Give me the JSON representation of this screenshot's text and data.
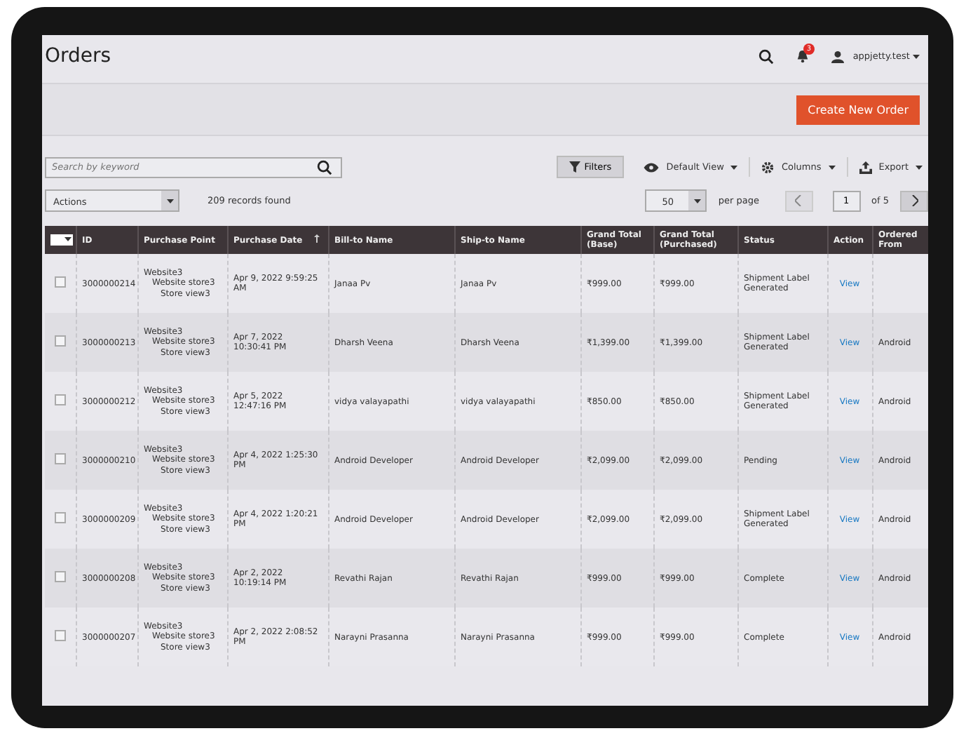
{
  "page": {
    "title": "Orders"
  },
  "header": {
    "notifications": "3",
    "user": "appjetty.test"
  },
  "create_button": "Create New Order",
  "search": {
    "placeholder": "Search by keyword"
  },
  "toolbar": {
    "filters": "Filters",
    "view": "Default View",
    "columns": "Columns",
    "export": "Export"
  },
  "actions": "Actions",
  "records": "209 records found",
  "pager": {
    "per_page_value": "50",
    "per_page_label": "per page",
    "page": "1",
    "of": "of 5"
  },
  "table": {
    "columns": [
      {
        "label": "ID",
        "sorted": false
      },
      {
        "label": "Purchase Point",
        "sorted": false
      },
      {
        "label": "Purchase Date",
        "sorted": true
      },
      {
        "label": "Bill-to Name",
        "sorted": false
      },
      {
        "label": "Ship-to Name",
        "sorted": false
      },
      {
        "label": "Grand Total (Base)",
        "sorted": false
      },
      {
        "label": "Grand Total (Purchased)",
        "sorted": false
      },
      {
        "label": "Status",
        "sorted": false
      },
      {
        "label": "Action",
        "sorted": false
      },
      {
        "label": "Ordered From",
        "sorted": false
      }
    ],
    "rows": [
      {
        "selected": false,
        "id": "3000000214",
        "point": [
          "Website3",
          "Website store3",
          "Store view3"
        ],
        "date": "Apr 9, 2022 9:59:25 AM",
        "bill": "Janaa Pv",
        "ship": "Janaa Pv",
        "base": "₹999.00",
        "purchased": "₹999.00",
        "status": "Shipment Label Generated",
        "action": "View"
      },
      {
        "selected": false,
        "id": "3000000213",
        "point": [
          "Website3",
          "Website store3",
          "Store view3"
        ],
        "date": "Apr 7, 2022 10:30:41 PM",
        "bill": "Dharsh Veena",
        "ship": "Dharsh Veena",
        "base": "₹1,399.00",
        "purchased": "₹1,399.00",
        "status": "Shipment Label Generated",
        "action": "View",
        "from": "Android"
      },
      {
        "selected": false,
        "id": "3000000212",
        "point": [
          "Website3",
          "Website store3",
          "Store view3"
        ],
        "date": "Apr 5, 2022 12:47:16 PM",
        "bill": "vidya valayapathi",
        "ship": "vidya valayapathi",
        "base": "₹850.00",
        "purchased": "₹850.00",
        "status": "Shipment Label Generated",
        "action": "View",
        "from": "Android"
      },
      {
        "selected": false,
        "id": "3000000210",
        "point": [
          "Website3",
          "Website store3",
          "Store view3"
        ],
        "date": "Apr 4, 2022 1:25:30 PM",
        "bill": "Android Developer",
        "ship": "Android Developer",
        "base": "₹2,099.00",
        "purchased": "₹2,099.00",
        "status": "Pending",
        "action": "View",
        "from": "Android"
      },
      {
        "selected": false,
        "id": "3000000209",
        "point": [
          "Website3",
          "Website store3",
          "Store view3"
        ],
        "date": "Apr 4, 2022 1:20:21 PM",
        "bill": "Android Developer",
        "ship": "Android Developer",
        "base": "₹2,099.00",
        "purchased": "₹2,099.00",
        "status": "Shipment Label Generated",
        "action": "View",
        "from": "Android"
      },
      {
        "selected": false,
        "id": "3000000208",
        "point": [
          "Website3",
          "Website store3",
          "Store view3"
        ],
        "date": "Apr 2, 2022 10:19:14 PM",
        "bill": "Revathi Rajan",
        "ship": "Revathi Rajan",
        "base": "₹999.00",
        "purchased": "₹999.00",
        "status": "Complete",
        "action": "View",
        "from": "Android"
      },
      {
        "selected": false,
        "id": "3000000207",
        "point": [
          "Website3",
          "Website store3",
          "Store view3"
        ],
        "date": "Apr 2, 2022 2:08:52 PM",
        "bill": "Narayni Prasanna",
        "ship": "Narayni Prasanna",
        "base": "₹999.00",
        "purchased": "₹999.00",
        "status": "Complete",
        "action": "View",
        "from": "Android"
      }
    ]
  }
}
